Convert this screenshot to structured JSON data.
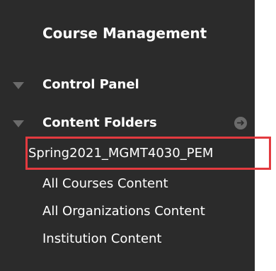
{
  "panel": {
    "title": "Course Management",
    "sections": {
      "control_panel": "Control Panel",
      "content_folders": "Content Folders"
    },
    "content_folders": {
      "items": [
        "Spring2021_MGMT4030_PEM",
        "All Courses Content",
        "All Organizations Content",
        "Institution Content"
      ]
    }
  },
  "colors": {
    "panel_bg": "#2b2b2b",
    "text": "#ffffff",
    "muted_icon": "#6b6b6b",
    "highlight_border": "#e33a3f"
  },
  "icons": {
    "collapse": "triangle-down-icon",
    "go": "arrow-right-circle-icon"
  }
}
